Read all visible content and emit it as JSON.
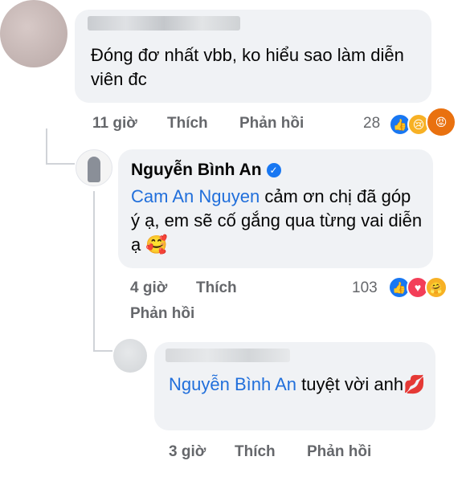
{
  "comments": [
    {
      "text": "Đóng đơ nhất vbb, ko hiểu sao làm diễn viên đc",
      "time": "11 giờ",
      "like_label": "Thích",
      "reply_label": "Phản hồi",
      "reaction_count": "28",
      "reactions": [
        "like-icon",
        "sad-icon",
        "angry-icon"
      ]
    },
    {
      "author": "Nguyễn Bình An",
      "mention": "Cam An Nguyen",
      "text": " cảm ơn chị đã góp ý ạ, em sẽ cố gắng qua từng vai diễn ạ ",
      "emoji": "🥰",
      "time": "4 giờ",
      "like_label": "Thích",
      "reply_label": "Phản hồi",
      "reaction_count": "103",
      "reactions": [
        "like-icon",
        "love-icon",
        "care-icon"
      ]
    },
    {
      "mention": "Nguyễn Bình An",
      "text": " tuyệt vời anh",
      "emoji": "💋",
      "time": "3 giờ",
      "like_label": "Thích",
      "reply_label": "Phản hồi"
    }
  ],
  "colors": {
    "bubble": "#f0f2f5",
    "mention": "#216fdb",
    "meta": "#65676b",
    "like": "#1877f2",
    "love": "#f33e58",
    "angry": "#e9710f"
  }
}
